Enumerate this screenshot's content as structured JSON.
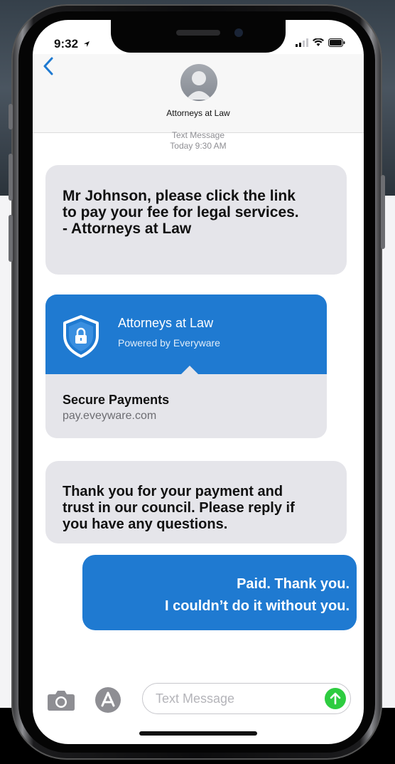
{
  "status_bar": {
    "time": "9:32"
  },
  "header": {
    "contact_name": "Attorneys at Law"
  },
  "conversation": {
    "service_label": "Text Message",
    "timestamp": "Today 9:30 AM",
    "messages": [
      {
        "direction": "incoming",
        "lines": [
          "Mr Johnson, please click the link",
          "to pay your fee for legal services.",
          "- Attorneys at Law"
        ]
      },
      {
        "direction": "incoming",
        "lines": [
          "Thank you for your payment and",
          "trust in our council. Please reply if",
          "you have any questions."
        ]
      },
      {
        "direction": "outgoing",
        "lines": [
          "Paid. Thank you.",
          "I couldn’t do it without you."
        ]
      }
    ],
    "link_preview": {
      "title": "Attorneys at Law",
      "subtitle": "Powered by Everyware",
      "label": "Secure Payments",
      "domain": "pay.eveyware.com",
      "icon": "shield-lock-icon"
    }
  },
  "composer": {
    "placeholder": "Text Message",
    "value": ""
  },
  "colors": {
    "accent_blue": "#1f7ad1",
    "incoming_bubble": "#e5e5ea",
    "send_green": "#2ecc40"
  }
}
